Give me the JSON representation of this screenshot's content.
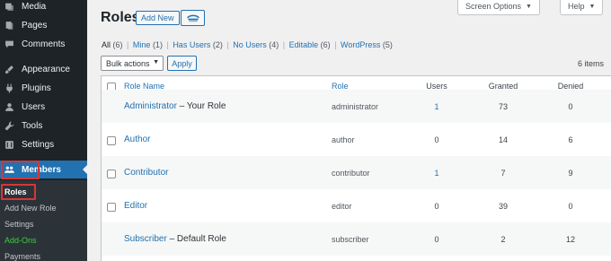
{
  "sidebar": {
    "items": [
      {
        "label": "Media",
        "icon": "media-icon"
      },
      {
        "label": "Pages",
        "icon": "pages-icon"
      },
      {
        "label": "Comments",
        "icon": "comments-icon"
      },
      {
        "label": "Appearance",
        "icon": "appearance-icon"
      },
      {
        "label": "Plugins",
        "icon": "plugins-icon"
      },
      {
        "label": "Users",
        "icon": "users-icon"
      },
      {
        "label": "Tools",
        "icon": "tools-icon"
      },
      {
        "label": "Settings",
        "icon": "settings-icon"
      },
      {
        "label": "Members",
        "icon": "members-icon"
      }
    ],
    "submenu": [
      "Roles",
      "Add New Role",
      "Settings",
      "Add-Ons",
      "Payments"
    ]
  },
  "header": {
    "title": "Roles",
    "add_new": "Add New",
    "screen_options": "Screen Options",
    "help": "Help"
  },
  "filters": [
    {
      "label": "All",
      "count": "(6)"
    },
    {
      "label": "Mine",
      "count": "(1)"
    },
    {
      "label": "Has Users",
      "count": "(2)"
    },
    {
      "label": "No Users",
      "count": "(4)"
    },
    {
      "label": "Editable",
      "count": "(6)"
    },
    {
      "label": "WordPress",
      "count": "(5)"
    }
  ],
  "toolbar": {
    "bulk_actions": "Bulk actions",
    "apply": "Apply",
    "items_count": "6 items"
  },
  "table": {
    "columns": [
      "Role Name",
      "Role",
      "Users",
      "Granted",
      "Denied"
    ],
    "rows": [
      {
        "name": "Administrator",
        "suffix": " – Your Role",
        "role": "administrator",
        "users": "1",
        "granted": "73",
        "denied": "0"
      },
      {
        "name": "Author",
        "suffix": "",
        "role": "author",
        "users": "0",
        "granted": "14",
        "denied": "6"
      },
      {
        "name": "Contributor",
        "suffix": "",
        "role": "contributor",
        "users": "1",
        "granted": "7",
        "denied": "9"
      },
      {
        "name": "Editor",
        "suffix": "",
        "role": "editor",
        "users": "0",
        "granted": "39",
        "denied": "0"
      },
      {
        "name": "Subscriber",
        "suffix": " – Default Role",
        "role": "subscriber",
        "users": "0",
        "granted": "2",
        "denied": "12"
      }
    ]
  },
  "colors": {
    "sidebar_bg": "#1d2327",
    "accent": "#2271b1",
    "highlight": "#d63638",
    "addons": "#38d13e"
  }
}
